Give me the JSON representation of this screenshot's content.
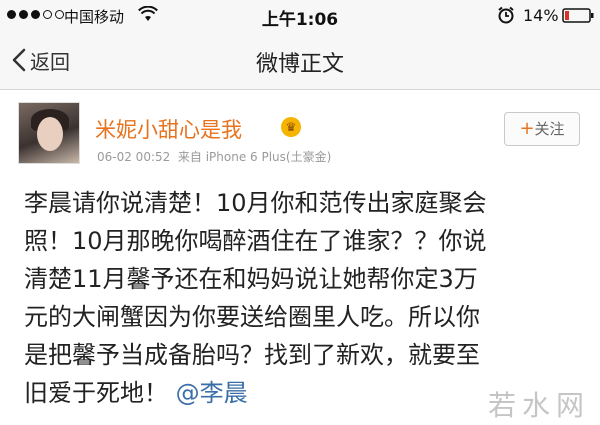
{
  "status_bar": {
    "carrier": "中国移动",
    "time": "上午1:06",
    "battery": "14%"
  },
  "nav": {
    "back_label": "返回",
    "title": "微博正文"
  },
  "post": {
    "username": "米妮小甜心是我",
    "date": "06-02 00:52",
    "source": "来自 iPhone 6 Plus(土豪金)",
    "follow_label": "关注",
    "text_lines": [
      "李晨请你说清楚！10月你和范传出家庭聚会",
      "照！10月那晚你喝醉酒住在了谁家？？你说",
      "清楚11月馨予还在和妈妈说让她帮你定3万",
      "元的大闸蟹因为你要送给圈里人吃。所以你",
      "是把馨予当成备胎吗？找到了新欢，就要至",
      "旧爱于死地！"
    ],
    "mention": "@李晨"
  },
  "watermark": "若水网",
  "colors": {
    "username": "#e8731f",
    "mention": "#3b6ea8",
    "bar_bg": "#f7f7f7"
  }
}
